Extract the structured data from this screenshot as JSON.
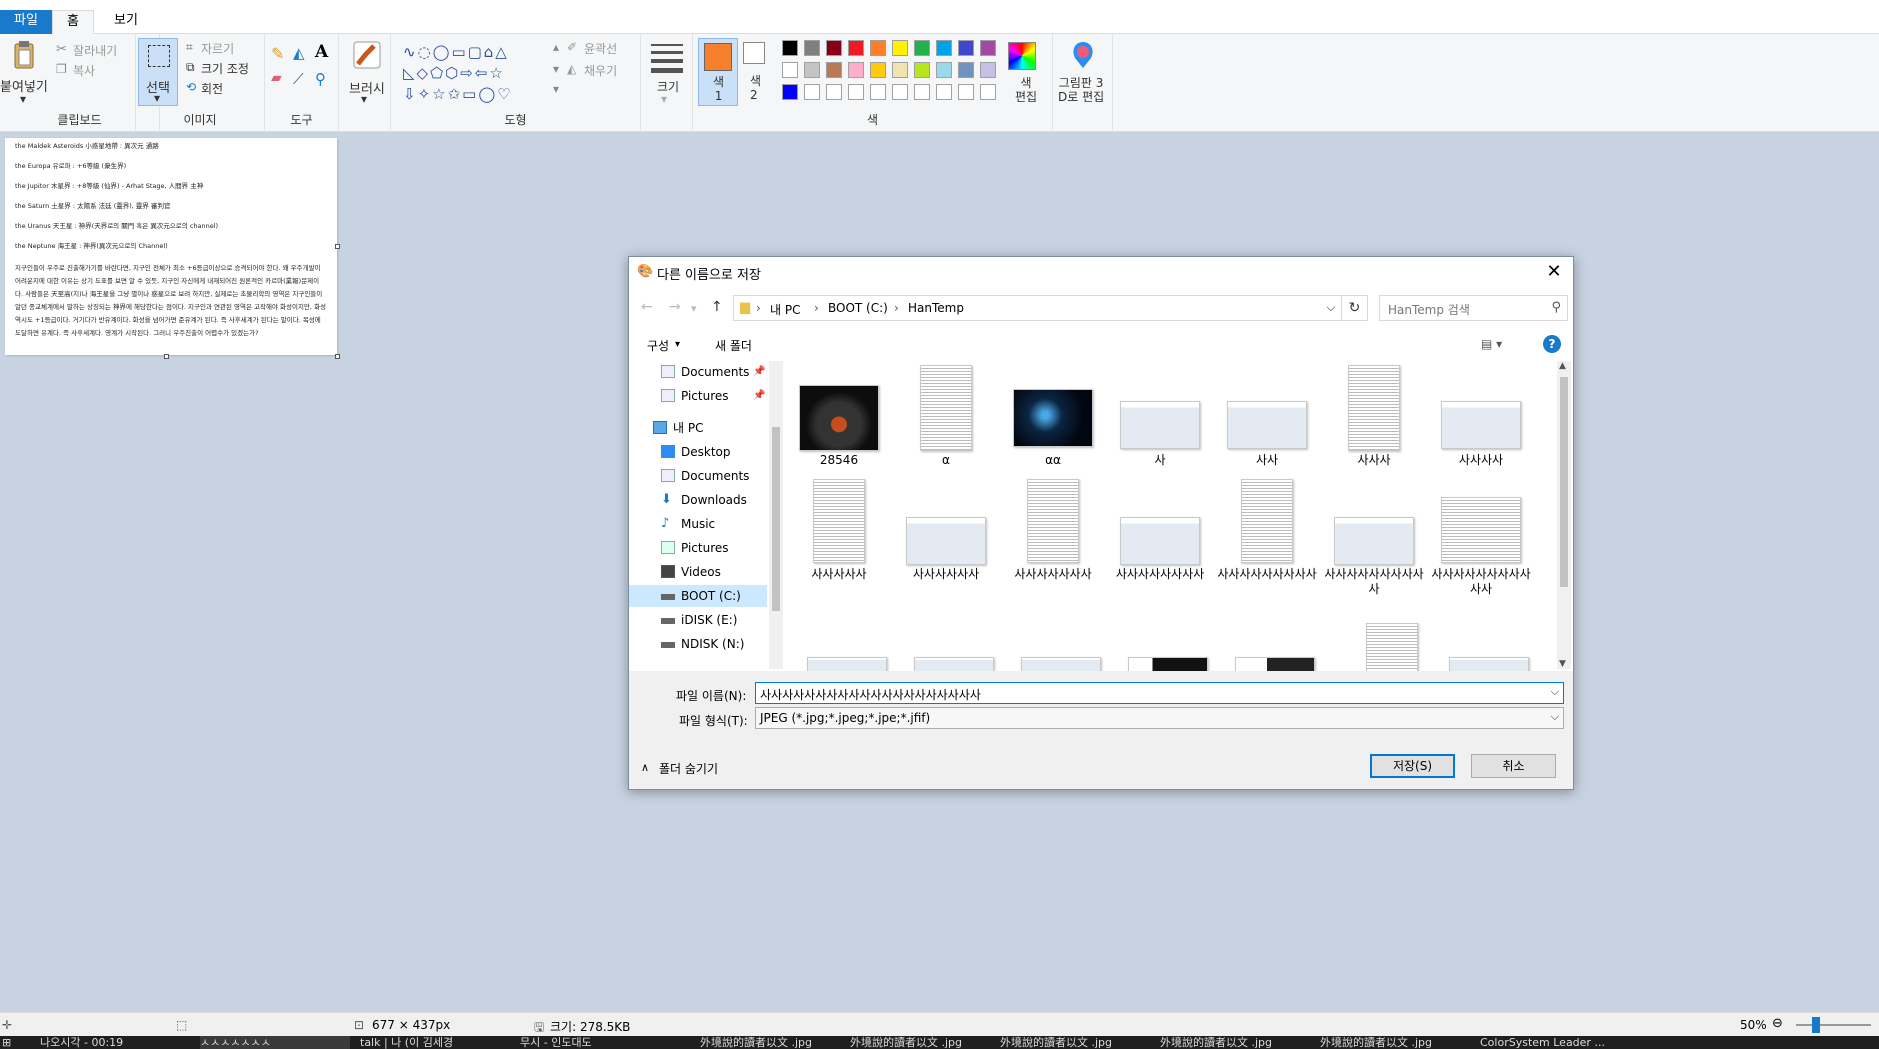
{
  "ribbon": {
    "tabs": [
      "파일",
      "홈",
      "보기"
    ],
    "clipboard": {
      "paste": "붙여넣기",
      "cut": "잘라내기",
      "copy": "복사",
      "label": "클립보드"
    },
    "image": {
      "select": "선택",
      "crop": "자르기",
      "resize": "크기 조정",
      "rotate": "회전",
      "label": "이미지"
    },
    "tools": {
      "label": "도구"
    },
    "brushes": {
      "label": "브러시"
    },
    "shapes": {
      "outline": "윤곽선",
      "fill": "채우기",
      "label": "도형"
    },
    "size": {
      "label": "크기"
    },
    "colors": {
      "color1": "색\n1",
      "color2": "색\n2",
      "edit": "색\n편집",
      "label": "색",
      "color1_hex": "#f7802c",
      "palette_row1": [
        "#000000",
        "#7f7f7f",
        "#880015",
        "#ed1c24",
        "#ff7f27",
        "#fff200",
        "#22b14c",
        "#00a2e8",
        "#3f48cc",
        "#a349a4"
      ],
      "palette_row2": [
        "#ffffff",
        "#c3c3c3",
        "#b97a57",
        "#ffaec9",
        "#ffc90e",
        "#efe4b0",
        "#b5e61d",
        "#99d9ea",
        "#7092be",
        "#c8bfe7"
      ],
      "palette_row3": [
        "#0000ff",
        "#ffffff",
        "#ffffff",
        "#ffffff",
        "#ffffff",
        "#ffffff",
        "#ffffff",
        "#ffffff",
        "#ffffff",
        "#ffffff"
      ]
    },
    "paint3d": {
      "label": "그림판 3\nD로 편집"
    }
  },
  "canvas_text": {
    "lines": [
      "the Maldek Asteroids 小惑星地帶 : 異次元 通路",
      "the Europa 유로파 : +6等級 (衆生界)",
      "the Jupitor 木星界 : +8等級 (仙界) - Arhat Stage, 人間界 主神",
      "the Saturn 土星界 : 太陽系 法廷 (靈界), 靈界 審判官",
      "the Uranus 天王星 : 神界(天界로의 關門 혹은 異次元으로의 channel)",
      "the Neptune 海王星 : 神界(異次元으로의 Channel)"
    ],
    "paragraph": "지구인들이 우주로 진출해가기를 바란다면, 지구인 전체가 최소 +6등급이상으로 승격되어야 한다. 왜 우주개발이 어려운지에 대한 이유는 상기 도표를 보면 알 수 있듯, 지구인 자신에게 내재되어진 원론적인 카르마(業報)문제이다. 사람들은 天至高(지)나 海王星을 그냥 별이나 惑星으로 보려 하지만, 실제로는 초물리학의 영역은 지구인들이 알던 종교체계에서 말하는 상징되는 神界에 해당한다는 점이다. 지구인과 연관된 영역은 고작해야 화성이지만, 화성 역시도 +1등급이다. 거기다가 반유계이다. 화성을 넘어가면 준유계가 된다. 즉 사후세계가 된다는 말이다. 목성에 도달하면 유계다. 즉 사후세계다. 영계가 시작된다. 그러니 우주진출이 어렵수가 있겠는가?"
  },
  "status": {
    "dimensions": "677 × 437px",
    "filesize": "크기: 278.5KB",
    "zoom": "50%"
  },
  "taskbar": {
    "items": [
      "나오시각 - 00:19",
      "ㅅㅅㅅㅅㅅㅅㅅ",
      "talk | 나 (이 김세경",
      "무시 - 인도대도",
      "外境說的讀者以文 .jpg",
      "外境說的讀者以文 .jpg",
      "外境說的讀者以文 .jpg",
      "外境說的讀者以文 .jpg",
      "外境說的讀者以文 .jpg",
      "ColorSystem Leader ..."
    ]
  },
  "dialog": {
    "title": "다른 이름으로 저장",
    "path": [
      "내 PC",
      "BOOT (C:)",
      "HanTemp"
    ],
    "search_placeholder": "HanTemp 검색",
    "organize": "구성",
    "new_folder": "새 폴더",
    "tree": [
      {
        "label": "Documents",
        "pinned": true
      },
      {
        "label": "Pictures",
        "pinned": true
      },
      {
        "label": "내 PC"
      },
      {
        "label": "Desktop"
      },
      {
        "label": "Documents"
      },
      {
        "label": "Downloads"
      },
      {
        "label": "Music"
      },
      {
        "label": "Pictures"
      },
      {
        "label": "Videos"
      },
      {
        "label": "BOOT (C:)",
        "selected": true
      },
      {
        "label": "iDISK (E:)"
      },
      {
        "label": "NDISK (N:)"
      }
    ],
    "files": [
      {
        "name": "28546",
        "kind": "dark1"
      },
      {
        "name": "α",
        "kind": "doc"
      },
      {
        "name": "αα",
        "kind": "dark2"
      },
      {
        "name": "사",
        "kind": "win"
      },
      {
        "name": "사사",
        "kind": "win"
      },
      {
        "name": "사사사",
        "kind": "doc"
      },
      {
        "name": "사사사사",
        "kind": "win"
      },
      {
        "name": "사사사사사",
        "kind": "doc"
      },
      {
        "name": "사사사사사사",
        "kind": "win"
      },
      {
        "name": "사사사사사사사",
        "kind": "doc"
      },
      {
        "name": "사사사사사사사사",
        "kind": "win"
      },
      {
        "name": "사사사사사사사사사",
        "kind": "doc"
      },
      {
        "name": "사사사사사사사사사사",
        "kind": "win"
      },
      {
        "name": "사사사사사사사사사사사",
        "kind": "doc"
      }
    ],
    "filename_label": "파일 이름(N):",
    "filename_value": "사사사사사사사사사사사사사사사사사사사사",
    "filetype_label": "파일 형식(T):",
    "filetype_value": "JPEG (*.jpg;*.jpeg;*.jpe;*.jfif)",
    "hide_folders": "폴더 숨기기",
    "save": "저장(S)",
    "cancel": "취소"
  }
}
